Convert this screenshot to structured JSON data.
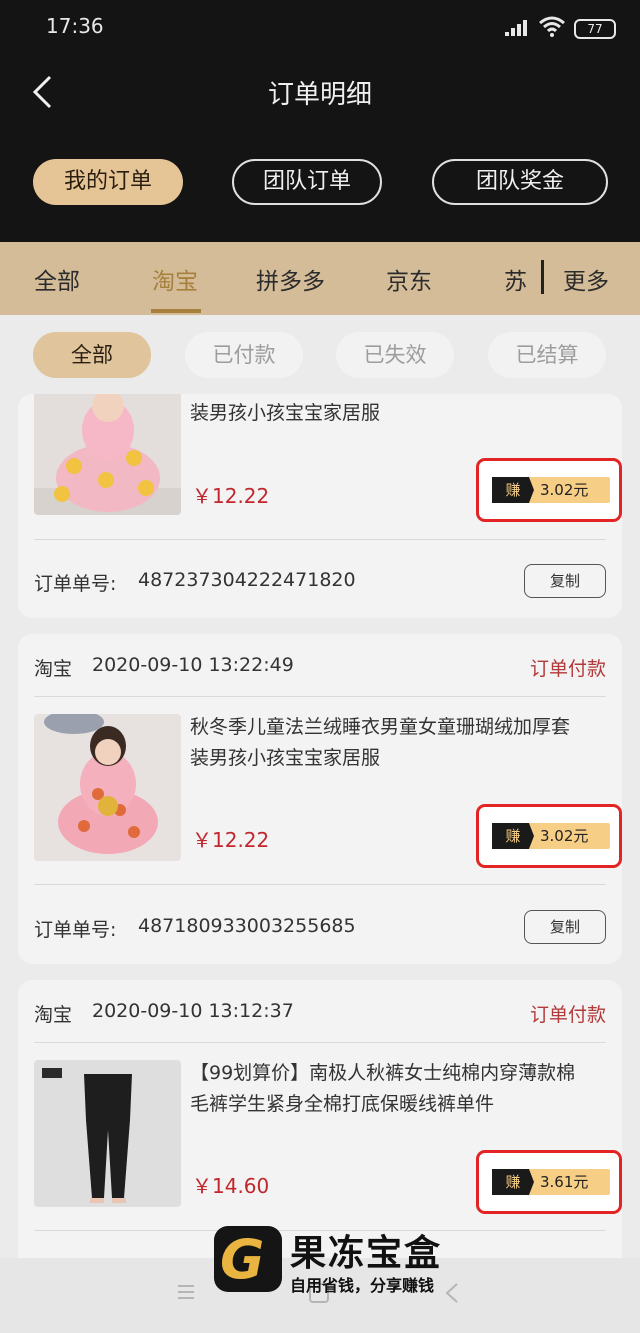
{
  "status": {
    "time": "17:36",
    "battery": "77"
  },
  "header": {
    "title": "订单明细"
  },
  "segments": [
    "我的订单",
    "团队订单",
    "团队奖金"
  ],
  "platforms": [
    "全部",
    "淘宝",
    "拼多多",
    "京东",
    "苏",
    "更多"
  ],
  "filters": [
    "全部",
    "已付款",
    "已失效",
    "已结算"
  ],
  "orders": [
    {
      "title_line": "装男孩小孩宝宝家居服",
      "price": "￥12.22",
      "earn_label": "赚",
      "earn": "3.02元",
      "order_no_label": "订单单号:",
      "order_no": "487237304222471820",
      "copy": "复制"
    },
    {
      "platform": "淘宝",
      "date": "2020-09-10 13:22:49",
      "status": "订单付款",
      "title_1": "秋冬季儿童法兰绒睡衣男童女童珊瑚绒加厚套",
      "title_2": "装男孩小孩宝宝家居服",
      "price": "￥12.22",
      "earn_label": "赚",
      "earn": "3.02元",
      "order_no_label": "订单单号:",
      "order_no": "487180933003255685",
      "copy": "复制"
    },
    {
      "platform": "淘宝",
      "date": "2020-09-10 13:12:37",
      "status": "订单付款",
      "title_1": "【99划算价】南极人秋裤女士纯棉内穿薄款棉",
      "title_2": "毛裤学生紧身全棉打底保暖线裤单件",
      "price": "￥14.60",
      "earn_label": "赚",
      "earn": "3.61元"
    }
  ],
  "watermark": {
    "name": "果冻宝盒",
    "slogan": "自用省钱，分享赚钱"
  }
}
